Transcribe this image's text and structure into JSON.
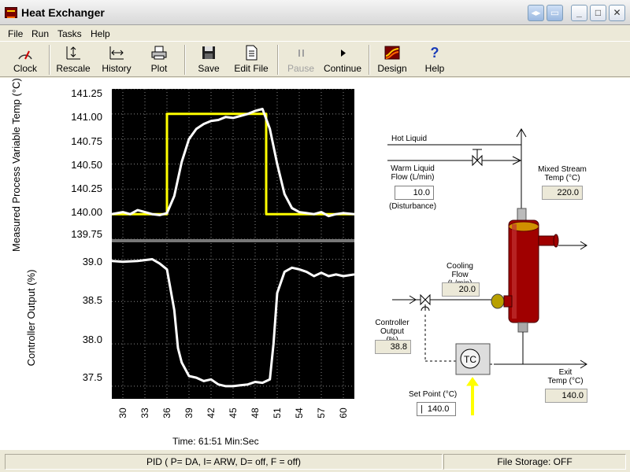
{
  "window": {
    "title": "Heat Exchanger"
  },
  "menu": [
    "File",
    "Run",
    "Tasks",
    "Help"
  ],
  "toolbar": {
    "clock": "Clock",
    "rescale": "Rescale",
    "history": "History",
    "plot": "Plot",
    "save": "Save",
    "edit_file": "Edit File",
    "pause": "Pause",
    "continue": "Continue",
    "design": "Design",
    "help": "Help"
  },
  "chart_data": [
    {
      "type": "line",
      "ylabel": "Measured Process Variable Temp (°C)",
      "ylim": [
        139.75,
        141.25
      ],
      "yticks": [
        "141.25",
        "141.00",
        "140.75",
        "140.50",
        "140.25",
        "140.00",
        "139.75"
      ],
      "grid": true,
      "series": [
        {
          "color": "#ffff00",
          "x": [
            28.5,
            36,
            36,
            49.5,
            49.5,
            61.5
          ],
          "y": [
            140.0,
            140.0,
            141.0,
            141.0,
            140.0,
            140.0
          ]
        },
        {
          "color": "#ffffff",
          "x": [
            28.5,
            30,
            31,
            32,
            33,
            34,
            35,
            36,
            37,
            38,
            39,
            40,
            41,
            42,
            43,
            44,
            45,
            46,
            47,
            48,
            49,
            50,
            51,
            52,
            53,
            54,
            55,
            56,
            57,
            58,
            59,
            60,
            61.5
          ],
          "y": [
            140.0,
            140.02,
            140.0,
            140.04,
            140.02,
            140.0,
            139.99,
            140.01,
            140.18,
            140.52,
            140.75,
            140.85,
            140.9,
            140.93,
            140.94,
            140.97,
            140.96,
            140.98,
            141.0,
            141.03,
            141.05,
            140.85,
            140.5,
            140.2,
            140.06,
            140.02,
            140.01,
            140.0,
            140.02,
            139.98,
            140.0,
            140.01,
            140.0
          ]
        }
      ]
    },
    {
      "type": "line",
      "ylabel": "Controller Output (%)",
      "ylim": [
        37.35,
        39.2
      ],
      "yticks": [
        "39.0",
        "38.5",
        "38.0",
        "37.5"
      ],
      "xlim": [
        28.5,
        61.5
      ],
      "xticks": [
        30,
        33,
        36,
        39,
        42,
        45,
        48,
        51,
        54,
        57,
        60
      ],
      "grid": true,
      "series": [
        {
          "color": "#ffffff",
          "x": [
            28.5,
            30,
            32,
            34,
            35,
            36,
            37,
            37.5,
            38,
            39,
            40,
            41,
            42,
            43,
            44,
            45,
            46,
            47,
            48,
            49,
            50,
            50.5,
            51,
            52,
            53,
            54,
            55,
            56,
            57,
            58,
            59,
            60,
            61.5
          ],
          "y": [
            38.98,
            38.97,
            38.98,
            39.0,
            38.95,
            38.88,
            38.4,
            37.95,
            37.78,
            37.62,
            37.6,
            37.56,
            37.58,
            37.52,
            37.5,
            37.5,
            37.51,
            37.52,
            37.55,
            37.54,
            37.58,
            38.0,
            38.6,
            38.85,
            38.9,
            38.88,
            38.85,
            38.8,
            38.84,
            38.8,
            38.82,
            38.8,
            38.82
          ]
        }
      ]
    }
  ],
  "plot": {
    "time_label": "Time:  61:51  Min:Sec"
  },
  "diagram": {
    "hot_liquid": "Hot Liquid",
    "warm_label": "Warm Liquid\nFlow  (L/min)",
    "warm_value": "10.0",
    "disturbance": "(Disturbance)",
    "mixed_label": "Mixed Stream\nTemp  (°C)",
    "mixed_value": "220.0",
    "cooling_label": "Cooling\nFlow  (L/min)",
    "cooling_value": "20.0",
    "co_label": "Controller\nOutput  (%)",
    "co_value": "38.8",
    "tc": "TC",
    "exit_label": "Exit\nTemp  (°C)",
    "exit_value": "140.0",
    "setpoint_label": "Set Point  (°C)",
    "setpoint_value": "140.0"
  },
  "status": {
    "left": "",
    "pid": "PID ( P= DA, I= ARW, D= off, F = off)",
    "storage": "File Storage:  OFF"
  },
  "colors": {
    "vessel": "#a00000",
    "setpoint_arrow": "#ffff00"
  }
}
